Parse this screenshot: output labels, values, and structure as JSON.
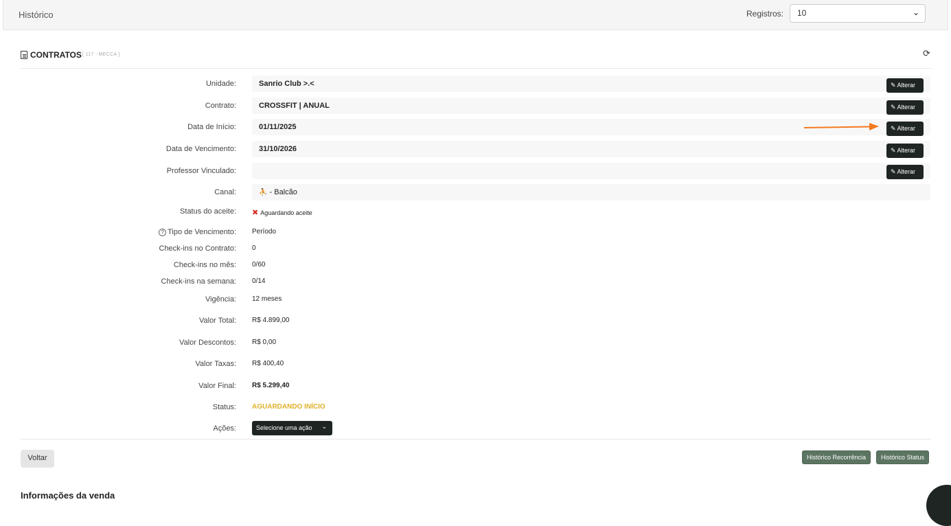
{
  "header": {
    "title": "Histórico",
    "registros_label": "Registros:",
    "registros_value": "10"
  },
  "section": {
    "title": "CONTRATOS",
    "subtitle": "[ 117 - MECCA ]"
  },
  "rows": {
    "unidade": {
      "label": "Unidade:",
      "value": "Sanrio Club >.<"
    },
    "contrato": {
      "label": "Contrato:",
      "value": "CROSSFIT | ANUAL"
    },
    "data_inicio": {
      "label": "Data de Início:",
      "value": "01/11/2025"
    },
    "data_vencimento": {
      "label": "Data de Vencimento:",
      "value": "31/10/2026"
    },
    "professor": {
      "label": "Professor Vinculado:",
      "value": ""
    },
    "canal": {
      "label": "Canal:",
      "value": "- Balcão"
    },
    "status_aceite": {
      "label": "Status do aceite:",
      "value": "Aguardando aceite"
    },
    "tipo_vencimento": {
      "label": "Tipo de Vencimento:",
      "value": "Período"
    },
    "checkins_contrato": {
      "label": "Check-ins no Contrato:",
      "value": "0"
    },
    "checkins_mes": {
      "label": "Check-ins no mês:",
      "value": "0/60"
    },
    "checkins_semana": {
      "label": "Check-ins na semana:",
      "value": "0/14"
    },
    "vigencia": {
      "label": "Vigência:",
      "value": "12 meses"
    },
    "valor_total": {
      "label": "Valor Total:",
      "value": "R$ 4.899,00"
    },
    "valor_descontos": {
      "label": "Valor Descontos:",
      "value": "R$ 0,00"
    },
    "valor_taxas": {
      "label": "Valor Taxas:",
      "value": "R$ 400,40"
    },
    "valor_final": {
      "label": "Valor Final:",
      "value": "R$ 5.299,40"
    },
    "status": {
      "label": "Status:",
      "value": "AGUARDANDO INÍCIO"
    },
    "acoes": {
      "label": "Ações:",
      "value": "Selecione uma ação"
    }
  },
  "buttons": {
    "alterar": "Alterar",
    "voltar": "Voltar",
    "historico_recorrencia": "Histórico Recorrência",
    "historico_status": "Histórico Status"
  },
  "footer": {
    "info_venda": "Informações da venda"
  },
  "colors": {
    "dark_button": "#1e2522",
    "green_button": "#5c7562",
    "status_yellow": "#e0b12a",
    "error_red": "#d9312b",
    "arrow_orange": "#f47a1f"
  },
  "icons": [
    "document-icon",
    "refresh-icon",
    "pencil-icon",
    "x-icon",
    "help-circle-icon",
    "chevron-down-icon",
    "counter-person-icon"
  ]
}
